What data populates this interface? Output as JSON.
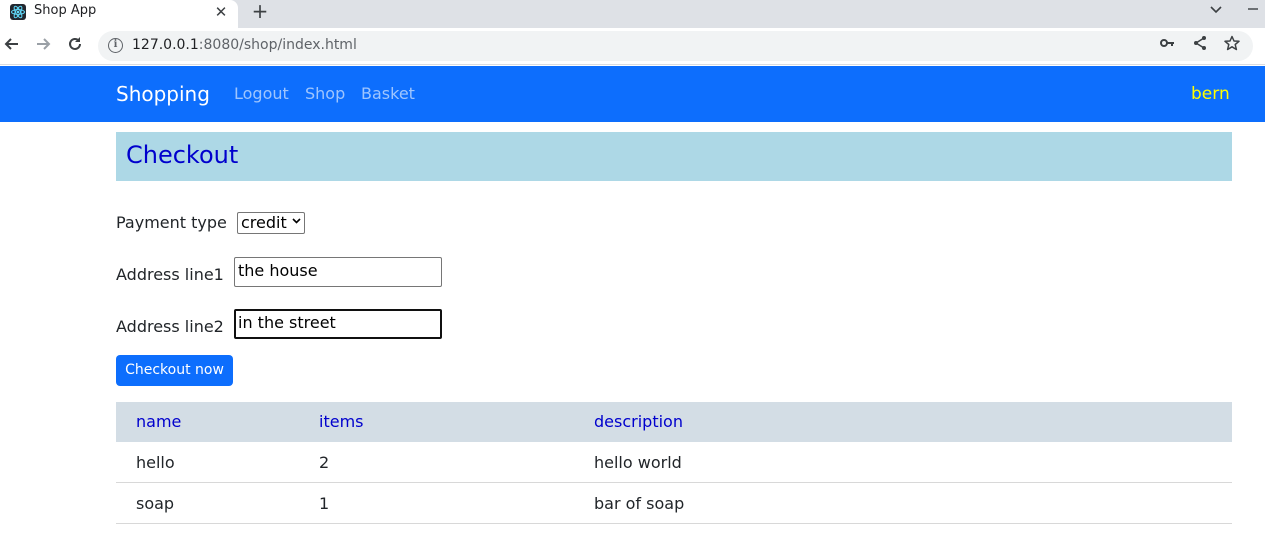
{
  "browser": {
    "tab_title": "Shop App",
    "tab_close": "✕",
    "new_tab": "+",
    "url_host": "127.0.0.1",
    "url_rest": ":8080/shop/index.html"
  },
  "navbar": {
    "brand": "Shopping",
    "links": [
      "Logout",
      "Shop",
      "Basket"
    ],
    "user": "bern"
  },
  "checkout": {
    "title": "Checkout",
    "payment_label": "Payment type",
    "payment_selected": "credit",
    "address1_label": "Address line1",
    "address1_value": "the house",
    "address2_label": "Address line2",
    "address2_value": "in the street",
    "submit_label": "Checkout now"
  },
  "table": {
    "headers": [
      "name",
      "items",
      "description"
    ],
    "rows": [
      [
        "hello",
        "2",
        "hello world"
      ],
      [
        "soap",
        "1",
        "bar of soap"
      ]
    ]
  },
  "colors": {
    "navbar": "#0d6efd",
    "header_bg": "#add8e6",
    "header_text": "#0000cd",
    "user_text": "#ffff00"
  }
}
